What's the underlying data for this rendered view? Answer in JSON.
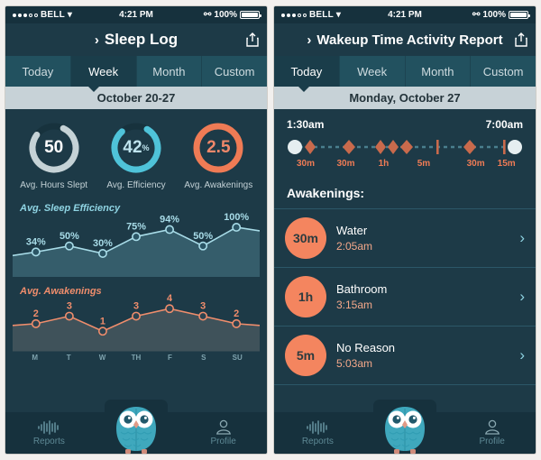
{
  "status_bar": {
    "signal_filled": 3,
    "signal_empty": 2,
    "carrier": "BELL",
    "wifi_icon": "wifi-icon",
    "time": "4:21 PM",
    "bluetooth_icon": "bluetooth-icon",
    "battery_percent": "100%",
    "battery_icon": "battery-full-icon"
  },
  "colors": {
    "header_navy": "#1d3a47",
    "tab_inactive": "#22515f",
    "tab_active": "#1a3d4a",
    "accent_cyan": "#4fc3d9",
    "accent_orange": "#ef7b55",
    "bubble_orange": "#f4855f",
    "date_band": "#c7d2d7",
    "gauge_gray": "#c5d2d6"
  },
  "left_screen": {
    "title": "Sleep Log",
    "back_icon": "chevron-right-icon",
    "share_icon": "share-icon",
    "tabs": [
      {
        "label": "Today",
        "active": false
      },
      {
        "label": "Week",
        "active": true
      },
      {
        "label": "Month",
        "active": false
      },
      {
        "label": "Custom",
        "active": false
      }
    ],
    "date_range": "October 20-27",
    "gauges": [
      {
        "value": "50",
        "suffix": "",
        "label": "Avg. Hours Slept",
        "color": "#c5d2d6",
        "percent": 78
      },
      {
        "value": "42",
        "suffix": "%",
        "label": "Avg. Efficiency",
        "color": "#4fc3d9",
        "percent": 80
      },
      {
        "value": "2.5",
        "suffix": "",
        "label": "Avg. Awakenings",
        "color": "#ef7b55",
        "percent": 100
      }
    ],
    "chart_data": [
      {
        "type": "line",
        "title": "Avg. Sleep Efficiency",
        "categories": [
          "M",
          "T",
          "W",
          "TH",
          "F",
          "S",
          "SU"
        ],
        "values": [
          34,
          50,
          30,
          75,
          94,
          50,
          100
        ],
        "labels": [
          "34%",
          "50%",
          "30%",
          "75%",
          "94%",
          "50%",
          "100%"
        ],
        "ylim": [
          0,
          110
        ],
        "xlabel": "",
        "ylabel": "",
        "grid": false,
        "line_color": "#a8dce8",
        "fill_color": "rgba(110,175,192,0.30)"
      },
      {
        "type": "line",
        "title": "Avg. Awakenings",
        "categories": [
          "M",
          "T",
          "W",
          "TH",
          "F",
          "S",
          "SU"
        ],
        "values": [
          2,
          3,
          1,
          3,
          4,
          3,
          2
        ],
        "labels": [
          "2",
          "3",
          "1",
          "3",
          "4",
          "3",
          "2"
        ],
        "ylim": [
          0,
          5
        ],
        "xlabel": "",
        "ylabel": "",
        "grid": false,
        "line_color": "#ef8d6c",
        "fill_color": "rgba(128,128,128,0.34)"
      }
    ],
    "day_labels": [
      "M",
      "T",
      "W",
      "TH",
      "F",
      "S",
      "SU"
    ]
  },
  "right_screen": {
    "title": "Wakeup Time Activity Report",
    "back_icon": "chevron-right-icon",
    "share_icon": "share-icon",
    "tabs": [
      {
        "label": "Today",
        "active": true
      },
      {
        "label": "Week",
        "active": false
      },
      {
        "label": "Month",
        "active": false
      },
      {
        "label": "Custom",
        "active": false
      }
    ],
    "date_range": "Monday, October 27",
    "timeline": {
      "start_time": "1:30am",
      "end_time": "7:00am",
      "markers": [
        {
          "label": "30m",
          "pos": 8
        },
        {
          "label": "30m",
          "pos": 25
        },
        {
          "label": "1h",
          "pos": 41
        },
        {
          "label": "5m",
          "pos": 58
        },
        {
          "label": "30m",
          "pos": 80
        },
        {
          "label": "15m",
          "pos": 93
        }
      ]
    },
    "awakenings_heading": "Awakenings:",
    "awakenings": [
      {
        "duration": "30m",
        "reason": "Water",
        "time": "2:05am",
        "chevron": "chevron-right-icon"
      },
      {
        "duration": "1h",
        "reason": "Bathroom",
        "time": "3:15am",
        "chevron": "chevron-right-icon"
      },
      {
        "duration": "5m",
        "reason": "No Reason",
        "time": "5:03am",
        "chevron": "chevron-right-icon"
      }
    ]
  },
  "tabbar": {
    "items": [
      {
        "label": "Reports",
        "icon": "waveform-icon"
      },
      {
        "label": "Profile",
        "icon": "person-icon"
      }
    ],
    "center_icon": "owl-icon"
  }
}
